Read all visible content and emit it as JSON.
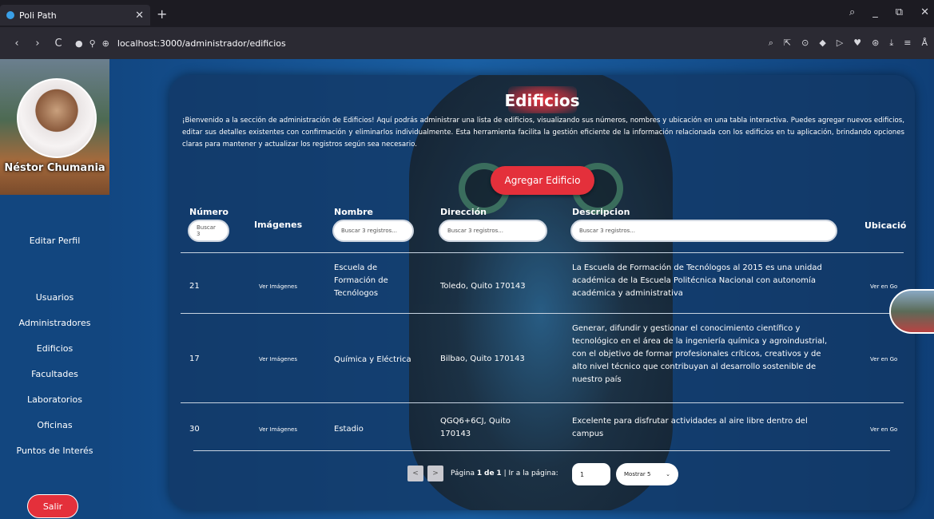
{
  "browser": {
    "tab_title": "Poli Path",
    "tab_close": "✕",
    "new_tab": "+",
    "url": "localhost:3000/administrador/edificios",
    "controls": [
      "⌕",
      "_",
      "⧉",
      "✕"
    ],
    "nav": [
      "‹",
      "›",
      "C"
    ],
    "url_icons": [
      "●",
      "⚲",
      "⊕"
    ],
    "extensions": [
      "⌕",
      "⇱",
      "⊙",
      "◆",
      "▷",
      "♥",
      "⊛",
      "⤓",
      "≡",
      "Å"
    ]
  },
  "sidebar": {
    "user_name": "Néstor Chumania",
    "edit_profile": "Editar Perfil",
    "items": [
      "Usuarios",
      "Administradores",
      "Edificios",
      "Facultades",
      "Laboratorios",
      "Oficinas",
      "Puntos de Interés"
    ],
    "logout": "Salir"
  },
  "main": {
    "title": "Edificios",
    "intro": "¡Bienvenido a la sección de administración de Edificios! Aquí podrás administrar una lista de edificios, visualizando sus números, nombres y ubicación en una tabla interactiva. Puedes agregar nuevos edificios, editar sus detalles existentes con confirmación y eliminarlos individualmente. Esta herramienta facilita la gestión eficiente de la información relacionada con los edificios en tu aplicación, brindando opciones claras para mantener y actualizar los registros según sea necesario.",
    "add_button": "Agregar Edificio",
    "columns": {
      "numero": "Número",
      "imagenes": "Imágenes",
      "nombre": "Nombre",
      "direccion": "Dirección",
      "descripcion": "Descripcion",
      "ubicacion": "Ubicació"
    },
    "filters": {
      "numero": "Buscar 3",
      "nombre": "Buscar 3 registros...",
      "direccion": "Buscar 3 registros...",
      "descripcion": "Buscar 3 registros..."
    },
    "rows": [
      {
        "numero": "21",
        "imagenes": "Ver Imágenes",
        "nombre": "Escuela de Formación de Tecnólogos",
        "direccion": "Toledo, Quito 170143",
        "descripcion": "La Escuela de Formación de Tecnólogos al 2015 es una unidad académica de la Escuela Politécnica Nacional con autonomía académica y administrativa",
        "ubicacion": "Ver en Go"
      },
      {
        "numero": "17",
        "imagenes": "Ver Imágenes",
        "nombre": "Química y Eléctrica",
        "direccion": "Bilbao, Quito 170143",
        "descripcion": "Generar, difundir y gestionar el conocimiento científico y tecnológico en el área de la ingeniería química y agroindustrial, con el objetivo de formar profesionales críticos, creativos y de alto nivel técnico que contribuyan al desarrollo sostenible de nuestro país",
        "ubicacion": "Ver en Go"
      },
      {
        "numero": "30",
        "imagenes": "Ver Imágenes",
        "nombre": "Estadio",
        "direccion": "QGQ6+6CJ, Quito 170143",
        "descripcion": "Excelente para disfrutar actividades al aire libre dentro del campus",
        "ubicacion": "Ver en Go"
      }
    ],
    "pagination": {
      "prev": "<",
      "next": ">",
      "page_label": "Página",
      "current": "1",
      "of": "de",
      "total": "1",
      "separator": "|",
      "go_to": "Ir a la página:",
      "go_value": "1",
      "show": "Mostrar 5",
      "chevron": "⌄"
    }
  }
}
